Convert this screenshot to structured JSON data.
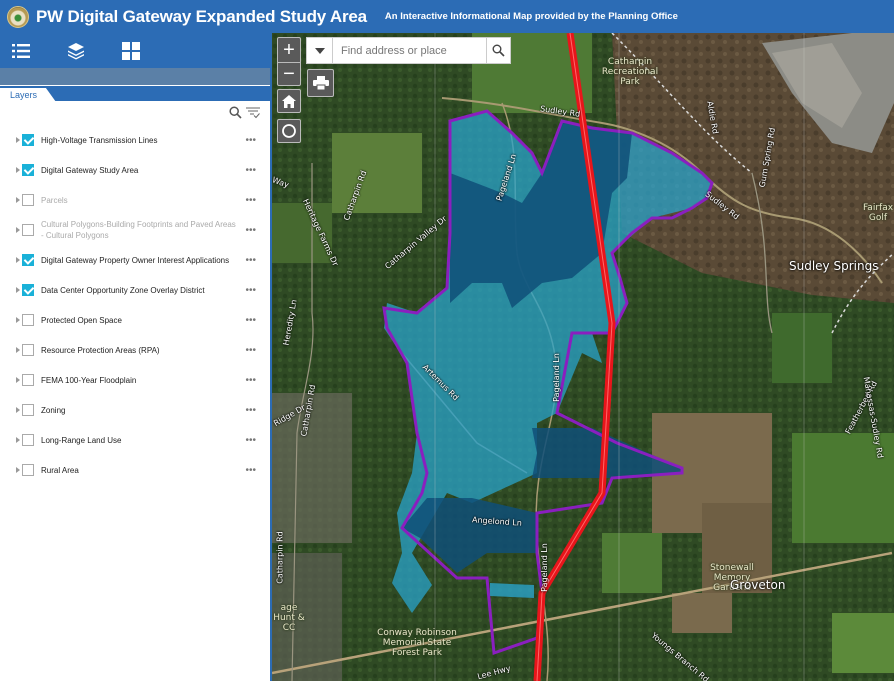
{
  "header": {
    "title": "PW Digital Gateway Expanded Study Area",
    "subtitle": "An Interactive Informational Map provided by the Planning Office",
    "logo_icon": "county-seal-logo"
  },
  "toolbar": {
    "tools": [
      {
        "name": "legend",
        "icon": "list-icon"
      },
      {
        "name": "layers",
        "icon": "layers-icon"
      },
      {
        "name": "basemap-gallery",
        "icon": "grid-icon"
      }
    ]
  },
  "panel": {
    "tab_label": "Layers",
    "tools": {
      "search_icon": "search-icon",
      "filter_icon": "filter-list-icon"
    },
    "layers": [
      {
        "label": "High-Voltage Transmission Lines",
        "checked": true,
        "dimmed": false
      },
      {
        "label": "Digital Gateway Study Area",
        "checked": true,
        "dimmed": false
      },
      {
        "label": "Parcels",
        "checked": false,
        "dimmed": true
      },
      {
        "label": "Cultural Polygons-Building Footprints and Paved Areas - Cultural Polygons",
        "checked": false,
        "dimmed": true
      },
      {
        "label": "Digital Gateway Property Owner Interest Applications",
        "checked": true,
        "dimmed": false
      },
      {
        "label": "Data Center Opportunity Zone Overlay District",
        "checked": true,
        "dimmed": false
      },
      {
        "label": "Protected Open Space",
        "checked": false,
        "dimmed": false
      },
      {
        "label": "Resource Protection Areas (RPA)",
        "checked": false,
        "dimmed": false
      },
      {
        "label": "FEMA 100-Year Floodplain",
        "checked": false,
        "dimmed": false
      },
      {
        "label": "Zoning",
        "checked": false,
        "dimmed": false
      },
      {
        "label": "Long-Range Land Use",
        "checked": false,
        "dimmed": false
      },
      {
        "label": "Rural Area",
        "checked": false,
        "dimmed": false
      }
    ],
    "more_label": "•••"
  },
  "map": {
    "zoom_in": "+",
    "zoom_out": "−",
    "search": {
      "placeholder": "Find address or place",
      "value": ""
    },
    "colors": {
      "study_area_fill": "#2aa3c9",
      "interest_fill": "#0f4f78",
      "boundary": "#8a1fbf",
      "transmission": "#e8151b"
    },
    "road_labels": [
      "Sudley Rd",
      "Sudley Rd",
      "Pageland Ln",
      "Pageland Ln",
      "Pageland Ln",
      "Catharpin Rd",
      "Catharpin Rd",
      "Catharpin Rd",
      "Catharpin Valley Dr",
      "Heritage Farms Dr",
      "Heredity Ln",
      "Artemus Rd",
      "Angelond Ln",
      "Lee Hwy",
      "Aldie Rd",
      "Gum Spring Rd",
      "Featherbed Rd",
      "Manassas-Sudley Rd",
      "Youngs Branch Rd",
      "Ridge Dr",
      "Way"
    ],
    "place_labels": [
      "Catharpin Recreational Park",
      "Conway Robinson Memorial State Forest Park",
      "Stonewall Memory Gardens",
      "Fairfax Golf",
      "age Hunt & CC"
    ],
    "towns": [
      "Sudley Springs",
      "Groveton"
    ]
  }
}
